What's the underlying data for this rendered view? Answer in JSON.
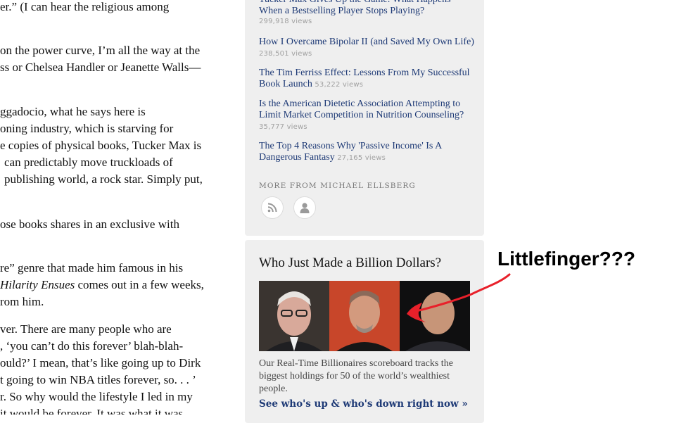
{
  "article": {
    "lines": [
      "er.” (I can hear the religious among",
      "on the power curve, I’m all the way at the",
      "ss or Chelsea Handler or Jeanette Walls—",
      "ggadocio, what he says here is",
      "oning industry, which is starving for",
      "e copies of physical books, Tucker Max is",
      "can predictably move truckloads of",
      "publishing world, a rock star. Simply put,",
      "ose books shares in an exclusive with",
      "re” genre that made him famous in his",
      "Hilarity Ensues",
      " comes out in a few weeks,",
      "rom him.",
      "ver. There are many people who are",
      ", ‘you can’t do this forever’ blah-blah-",
      "ould?’ I mean, that’s like going up to Dirk",
      "t going to win NBA titles forever, so. . . ’",
      "r. So why would the lifestyle I led in my",
      "it would be forever. It was what it was"
    ]
  },
  "sidebar": {
    "stories": [
      {
        "title": "Tucker Max Gives Up the Game: What Happens When a Bestselling Player Stops Playing?",
        "views": "299,918 views"
      },
      {
        "title": "How I Overcame Bipolar II (and Saved My Own Life)",
        "views": "238,501 views"
      },
      {
        "title": "The Tim Ferriss Effect: Lessons From My Successful Book Launch",
        "views": "53,222 views"
      },
      {
        "title": "Is the American Dietetic Association Attempting to Limit Market Competition in Nutrition Counseling?",
        "views": "35,777 views"
      },
      {
        "title": "The Top 4 Reasons Why 'Passive Income' Is A Dangerous Fantasy",
        "views": "27,165 views"
      }
    ],
    "more_from": "MORE FROM MICHAEL ELLSBERG",
    "icons": [
      "rss-icon",
      "profile-icon"
    ]
  },
  "promo": {
    "title": "Who Just Made a Billion Dollars?",
    "text": "Our Real-Time Billionaires scoreboard tracks the biggest holdings for 50 of the world’s wealthiest people.",
    "link": "See who's up & who's down right now »"
  },
  "annotation": {
    "text": "Littlefinger???",
    "color": "#e8202a"
  },
  "colors": {
    "link": "#1e3a76",
    "panel_bg": "#efefef",
    "views": "#a0a0a0"
  }
}
